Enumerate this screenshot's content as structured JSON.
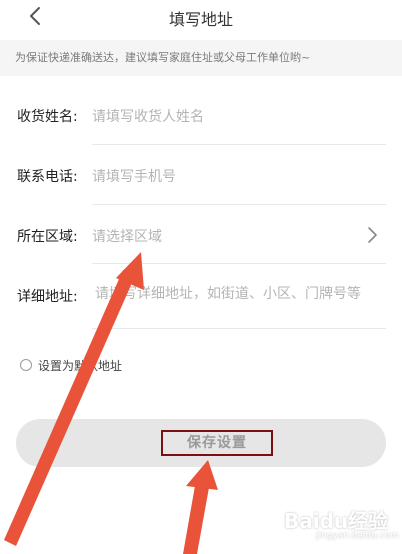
{
  "header": {
    "title": "填写地址",
    "back_icon": "chevron-left-icon"
  },
  "notice": "为保证快递准确送达，建议填写家庭住址或父母工作单位哟~",
  "form": {
    "name_label": "收货姓名:",
    "name_placeholder": "请填写收货人姓名",
    "phone_label": "联系电话:",
    "phone_placeholder": "请填写手机号",
    "region_label": "所在区域:",
    "region_placeholder": "请选择区域",
    "region_icon": "chevron-right-icon",
    "address_label": "详细地址:",
    "address_placeholder": "请填写详细地址，如街道、小区、门牌号等"
  },
  "default_address": {
    "label": "设置为默认地址",
    "checked": false
  },
  "save_button": {
    "label": "保存设置"
  },
  "annotation_color": "#e8533a",
  "highlight_color": "#7a1010",
  "watermark": {
    "text": "Baidu经验",
    "sub": "jingyan.baidu.com"
  }
}
